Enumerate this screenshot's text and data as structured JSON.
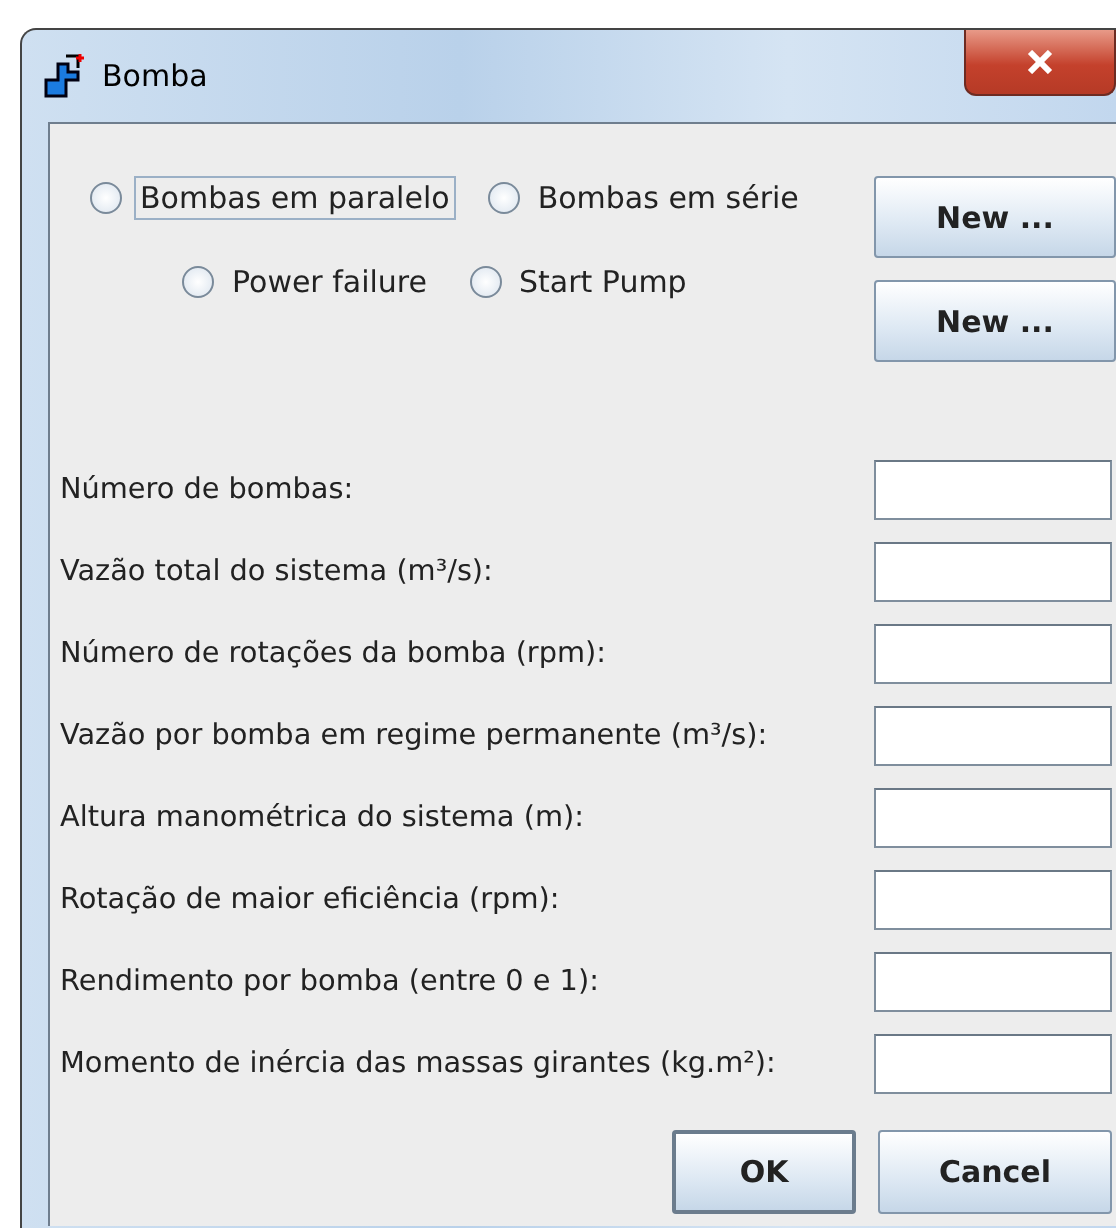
{
  "window": {
    "title": "Bomba"
  },
  "radio_rows": [
    [
      {
        "label": "Bombas em paralelo",
        "selected": false,
        "focused": true
      },
      {
        "label": "Bombas em série",
        "selected": false,
        "focused": false
      }
    ],
    [
      {
        "label": "Power failure",
        "selected": false,
        "focused": false
      },
      {
        "label": "Start Pump",
        "selected": false,
        "focused": false
      }
    ]
  ],
  "side_buttons": [
    "New ...",
    "New ..."
  ],
  "fields": [
    {
      "label": "Número de bombas:"
    },
    {
      "label": "Vazão total do sistema (m³/s):"
    },
    {
      "label": "Número de rotações da bomba (rpm):"
    },
    {
      "label": "Vazão por bomba em regime permanente (m³/s):"
    },
    {
      "label": "Altura manométrica do sistema (m):"
    },
    {
      "label": "Rotação de maior eficiência (rpm):"
    },
    {
      "label": "Rendimento por bomba (entre 0 e 1):"
    },
    {
      "label": "Momento de inércia das massas girantes (kg.m²):"
    }
  ],
  "buttons": [
    {
      "label": "OK",
      "default": true
    },
    {
      "label": "Cancel",
      "default": false
    }
  ]
}
